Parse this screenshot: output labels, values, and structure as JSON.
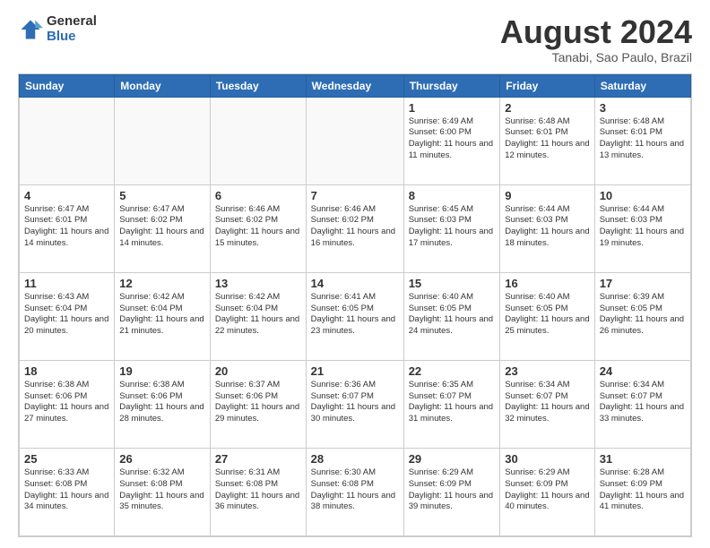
{
  "logo": {
    "general": "General",
    "blue": "Blue"
  },
  "title": "August 2024",
  "location": "Tanabi, Sao Paulo, Brazil",
  "days_header": [
    "Sunday",
    "Monday",
    "Tuesday",
    "Wednesday",
    "Thursday",
    "Friday",
    "Saturday"
  ],
  "weeks": [
    [
      {
        "day": "",
        "info": ""
      },
      {
        "day": "",
        "info": ""
      },
      {
        "day": "",
        "info": ""
      },
      {
        "day": "",
        "info": ""
      },
      {
        "day": "1",
        "info": "Sunrise: 6:49 AM\nSunset: 6:00 PM\nDaylight: 11 hours and 11 minutes."
      },
      {
        "day": "2",
        "info": "Sunrise: 6:48 AM\nSunset: 6:01 PM\nDaylight: 11 hours and 12 minutes."
      },
      {
        "day": "3",
        "info": "Sunrise: 6:48 AM\nSunset: 6:01 PM\nDaylight: 11 hours and 13 minutes."
      }
    ],
    [
      {
        "day": "4",
        "info": "Sunrise: 6:47 AM\nSunset: 6:01 PM\nDaylight: 11 hours and 14 minutes."
      },
      {
        "day": "5",
        "info": "Sunrise: 6:47 AM\nSunset: 6:02 PM\nDaylight: 11 hours and 14 minutes."
      },
      {
        "day": "6",
        "info": "Sunrise: 6:46 AM\nSunset: 6:02 PM\nDaylight: 11 hours and 15 minutes."
      },
      {
        "day": "7",
        "info": "Sunrise: 6:46 AM\nSunset: 6:02 PM\nDaylight: 11 hours and 16 minutes."
      },
      {
        "day": "8",
        "info": "Sunrise: 6:45 AM\nSunset: 6:03 PM\nDaylight: 11 hours and 17 minutes."
      },
      {
        "day": "9",
        "info": "Sunrise: 6:44 AM\nSunset: 6:03 PM\nDaylight: 11 hours and 18 minutes."
      },
      {
        "day": "10",
        "info": "Sunrise: 6:44 AM\nSunset: 6:03 PM\nDaylight: 11 hours and 19 minutes."
      }
    ],
    [
      {
        "day": "11",
        "info": "Sunrise: 6:43 AM\nSunset: 6:04 PM\nDaylight: 11 hours and 20 minutes."
      },
      {
        "day": "12",
        "info": "Sunrise: 6:42 AM\nSunset: 6:04 PM\nDaylight: 11 hours and 21 minutes."
      },
      {
        "day": "13",
        "info": "Sunrise: 6:42 AM\nSunset: 6:04 PM\nDaylight: 11 hours and 22 minutes."
      },
      {
        "day": "14",
        "info": "Sunrise: 6:41 AM\nSunset: 6:05 PM\nDaylight: 11 hours and 23 minutes."
      },
      {
        "day": "15",
        "info": "Sunrise: 6:40 AM\nSunset: 6:05 PM\nDaylight: 11 hours and 24 minutes."
      },
      {
        "day": "16",
        "info": "Sunrise: 6:40 AM\nSunset: 6:05 PM\nDaylight: 11 hours and 25 minutes."
      },
      {
        "day": "17",
        "info": "Sunrise: 6:39 AM\nSunset: 6:05 PM\nDaylight: 11 hours and 26 minutes."
      }
    ],
    [
      {
        "day": "18",
        "info": "Sunrise: 6:38 AM\nSunset: 6:06 PM\nDaylight: 11 hours and 27 minutes."
      },
      {
        "day": "19",
        "info": "Sunrise: 6:38 AM\nSunset: 6:06 PM\nDaylight: 11 hours and 28 minutes."
      },
      {
        "day": "20",
        "info": "Sunrise: 6:37 AM\nSunset: 6:06 PM\nDaylight: 11 hours and 29 minutes."
      },
      {
        "day": "21",
        "info": "Sunrise: 6:36 AM\nSunset: 6:07 PM\nDaylight: 11 hours and 30 minutes."
      },
      {
        "day": "22",
        "info": "Sunrise: 6:35 AM\nSunset: 6:07 PM\nDaylight: 11 hours and 31 minutes."
      },
      {
        "day": "23",
        "info": "Sunrise: 6:34 AM\nSunset: 6:07 PM\nDaylight: 11 hours and 32 minutes."
      },
      {
        "day": "24",
        "info": "Sunrise: 6:34 AM\nSunset: 6:07 PM\nDaylight: 11 hours and 33 minutes."
      }
    ],
    [
      {
        "day": "25",
        "info": "Sunrise: 6:33 AM\nSunset: 6:08 PM\nDaylight: 11 hours and 34 minutes."
      },
      {
        "day": "26",
        "info": "Sunrise: 6:32 AM\nSunset: 6:08 PM\nDaylight: 11 hours and 35 minutes."
      },
      {
        "day": "27",
        "info": "Sunrise: 6:31 AM\nSunset: 6:08 PM\nDaylight: 11 hours and 36 minutes."
      },
      {
        "day": "28",
        "info": "Sunrise: 6:30 AM\nSunset: 6:08 PM\nDaylight: 11 hours and 38 minutes."
      },
      {
        "day": "29",
        "info": "Sunrise: 6:29 AM\nSunset: 6:09 PM\nDaylight: 11 hours and 39 minutes."
      },
      {
        "day": "30",
        "info": "Sunrise: 6:29 AM\nSunset: 6:09 PM\nDaylight: 11 hours and 40 minutes."
      },
      {
        "day": "31",
        "info": "Sunrise: 6:28 AM\nSunset: 6:09 PM\nDaylight: 11 hours and 41 minutes."
      }
    ]
  ]
}
